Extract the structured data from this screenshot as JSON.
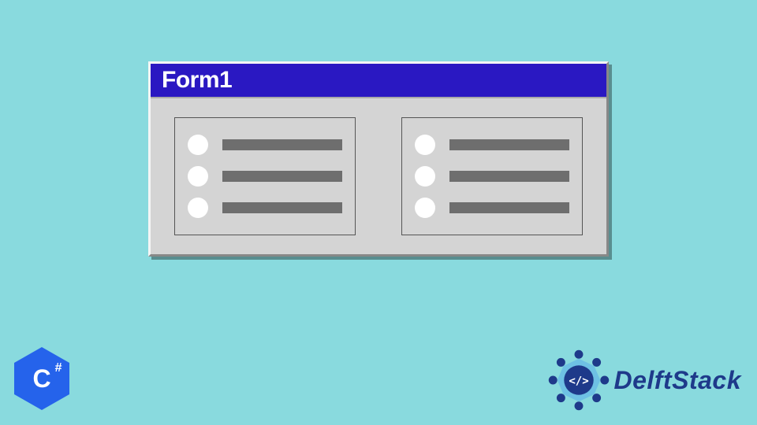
{
  "window": {
    "title": "Form1"
  },
  "badge": {
    "lang": "C",
    "sharp": "#"
  },
  "brand": {
    "name": "DelftStack"
  },
  "groups": {
    "left": {
      "rows": 3
    },
    "right": {
      "rows": 3
    }
  }
}
